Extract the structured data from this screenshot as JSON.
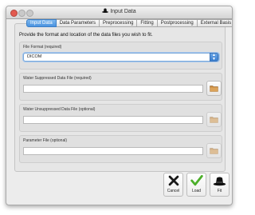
{
  "window": {
    "title": "Input Data"
  },
  "tabs": [
    {
      "label": "Input Data",
      "active": true
    },
    {
      "label": "Data Parameters",
      "active": false
    },
    {
      "label": "Preprocessing",
      "active": false
    },
    {
      "label": "Fitting",
      "active": false
    },
    {
      "label": "Postprocessing",
      "active": false
    },
    {
      "label": "External Basis",
      "active": false
    }
  ],
  "instruction": "Provide the format and location of the data files you wish to fit.",
  "file_format": {
    "label": "File Format (required)",
    "selected": "DICOM"
  },
  "water_suppressed": {
    "label": "Water Suppressed Data File (required)",
    "value": "",
    "browse_enabled": true
  },
  "water_unsuppressed": {
    "label": "Water Unsuppressed Data File (optional)",
    "value": "",
    "browse_enabled": false
  },
  "parameter_file": {
    "label": "Parameter File (optional)",
    "value": "",
    "browse_enabled": false
  },
  "actions": {
    "cancel_label": "Cancel",
    "load_label": "Load",
    "fit_label": "Fit"
  },
  "colors": {
    "accent": "#4a93df",
    "cancel_icon": "#1a1a1a",
    "load_icon": "#4caf2a",
    "folder_icon": "#c88a3e"
  },
  "icons": {
    "title": "hat-icon",
    "browse": "folder-icon",
    "cancel": "x-icon",
    "load": "checkmark-icon",
    "fit": "hat-icon"
  }
}
